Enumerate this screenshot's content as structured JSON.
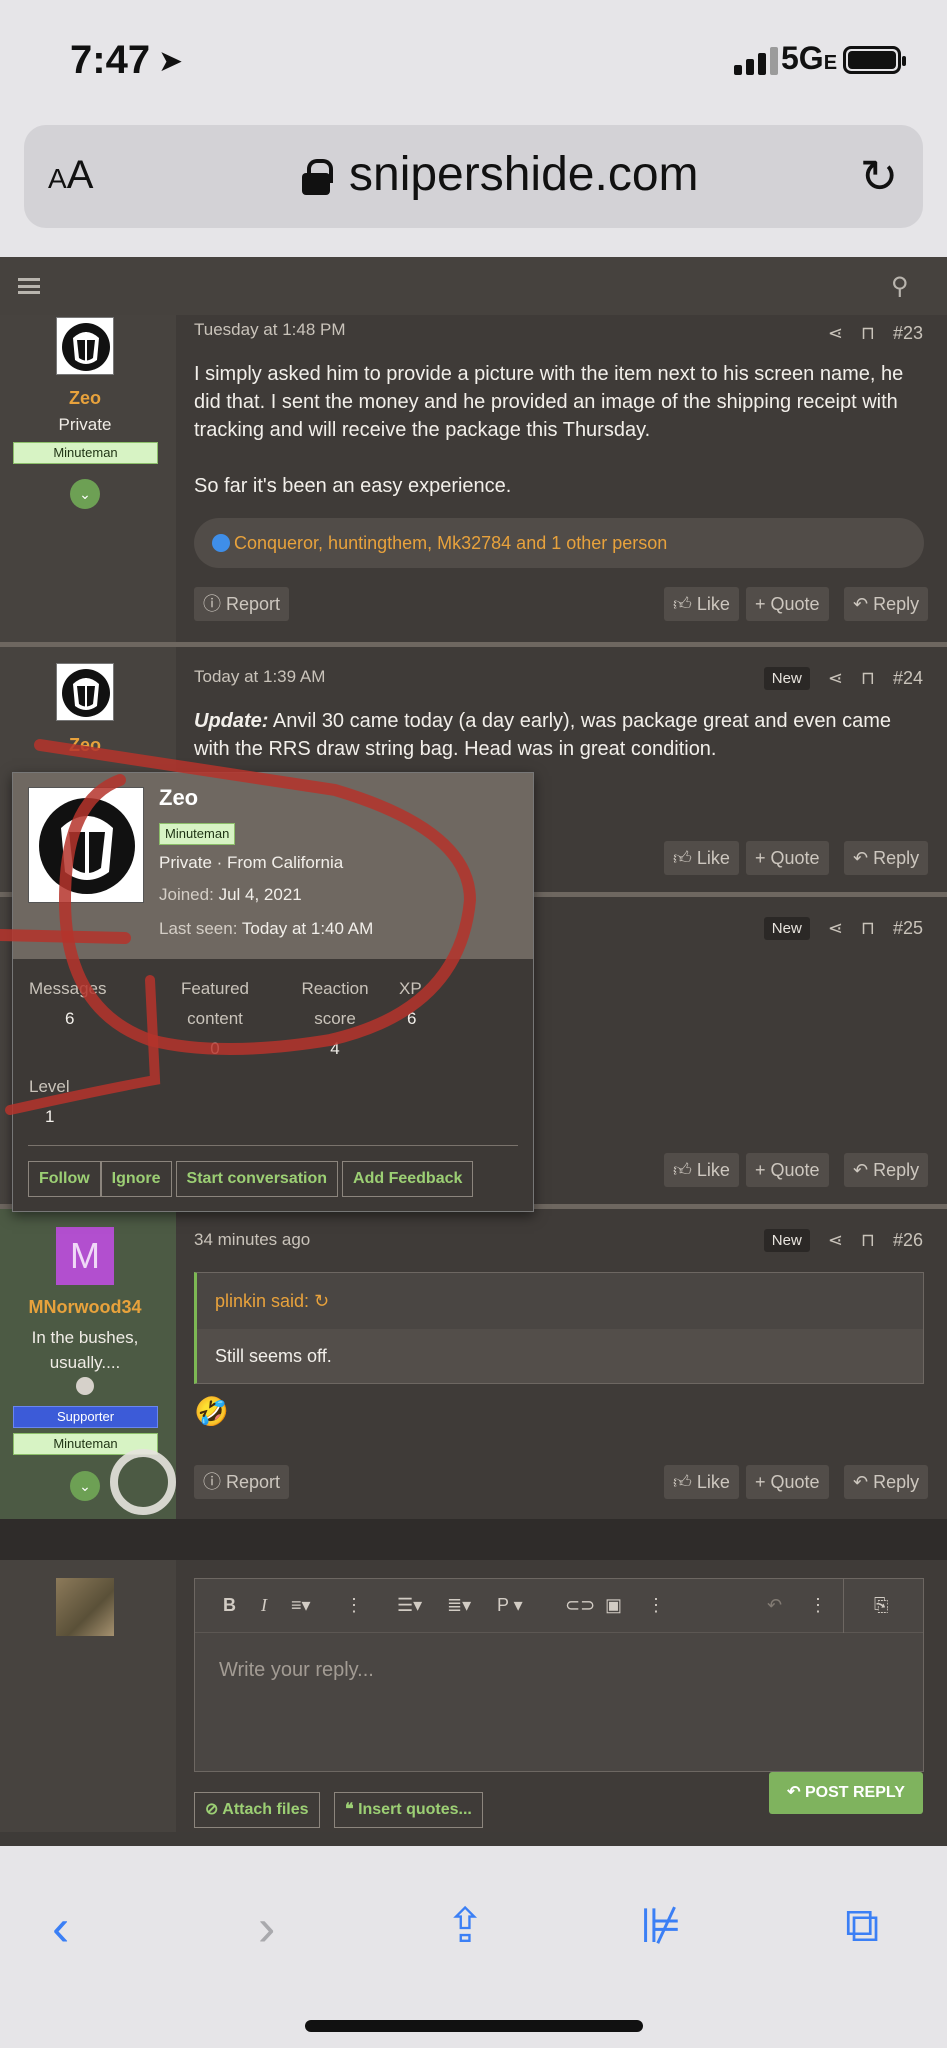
{
  "status": {
    "time": "7:47",
    "network": "5G",
    "network_sub": "E"
  },
  "browser": {
    "domain": "snipershide.com",
    "aa_label": "AA"
  },
  "posts": [
    {
      "user": {
        "name": "Zeo",
        "title": "Private",
        "badge": "Minuteman"
      },
      "date": "Tuesday at 1:48 PM",
      "number": "#23",
      "body1": "I simply asked him to provide a picture with the item next to his screen name, he did that. I sent the money and he provided an image of the shipping receipt with tracking and will receive the package this Thursday.",
      "body2": "So far it's been an easy experience.",
      "reactions": "Conqueror, huntingthem, Mk32784 and 1 other person",
      "report": "Report",
      "like": "Like",
      "quote": "+ Quote",
      "reply": "Reply"
    },
    {
      "user": {
        "name": "Zeo",
        "title": "Private"
      },
      "date": "Today at 1:39 AM",
      "new": "New",
      "number": "#24",
      "body_bold": "Update:",
      "body": " Anvil 30 came today (a day early), was package great and even came with the RRS draw string bag. Head was in great condition.",
      "like": "Like",
      "quote": "+ Quote",
      "reply": "Reply"
    },
    {
      "new": "New",
      "number": "#25",
      "like": "Like",
      "quote": "+ Quote",
      "reply": "Reply"
    },
    {
      "user": {
        "name": "MNorwood34",
        "initial": "M",
        "title": "In the bushes, usually....",
        "badge_supporter": "Supporter",
        "badge": "Minuteman"
      },
      "date": "34 minutes ago",
      "new": "New",
      "number": "#26",
      "quote_author": "plinkin said:",
      "quote_body": "Still seems off.",
      "emoji": "🤣",
      "report": "Report",
      "like": "Like",
      "quote": "+ Quote",
      "reply": "Reply"
    }
  ],
  "popup": {
    "name": "Zeo",
    "badge": "Minuteman",
    "line1": "Private · From California",
    "joined_label": "Joined:",
    "joined": "Jul 4, 2021",
    "seen_label": "Last seen:",
    "seen": "Today at 1:40 AM",
    "stats": {
      "messages_label": "Messages",
      "messages": "6",
      "featured_label1": "Featured",
      "featured_label2": "content",
      "featured": "0",
      "reaction_label1": "Reaction",
      "reaction_label2": "score",
      "reaction": "4",
      "xp_label": "XP",
      "xp": "6",
      "level_label": "Level",
      "level": "1"
    },
    "buttons": [
      "Follow",
      "Ignore",
      "Start conversation",
      "Add Feedback"
    ]
  },
  "editor": {
    "placeholder": "Write your reply...",
    "attach": "Attach files",
    "insert": "Insert quotes...",
    "post": "POST REPLY"
  }
}
